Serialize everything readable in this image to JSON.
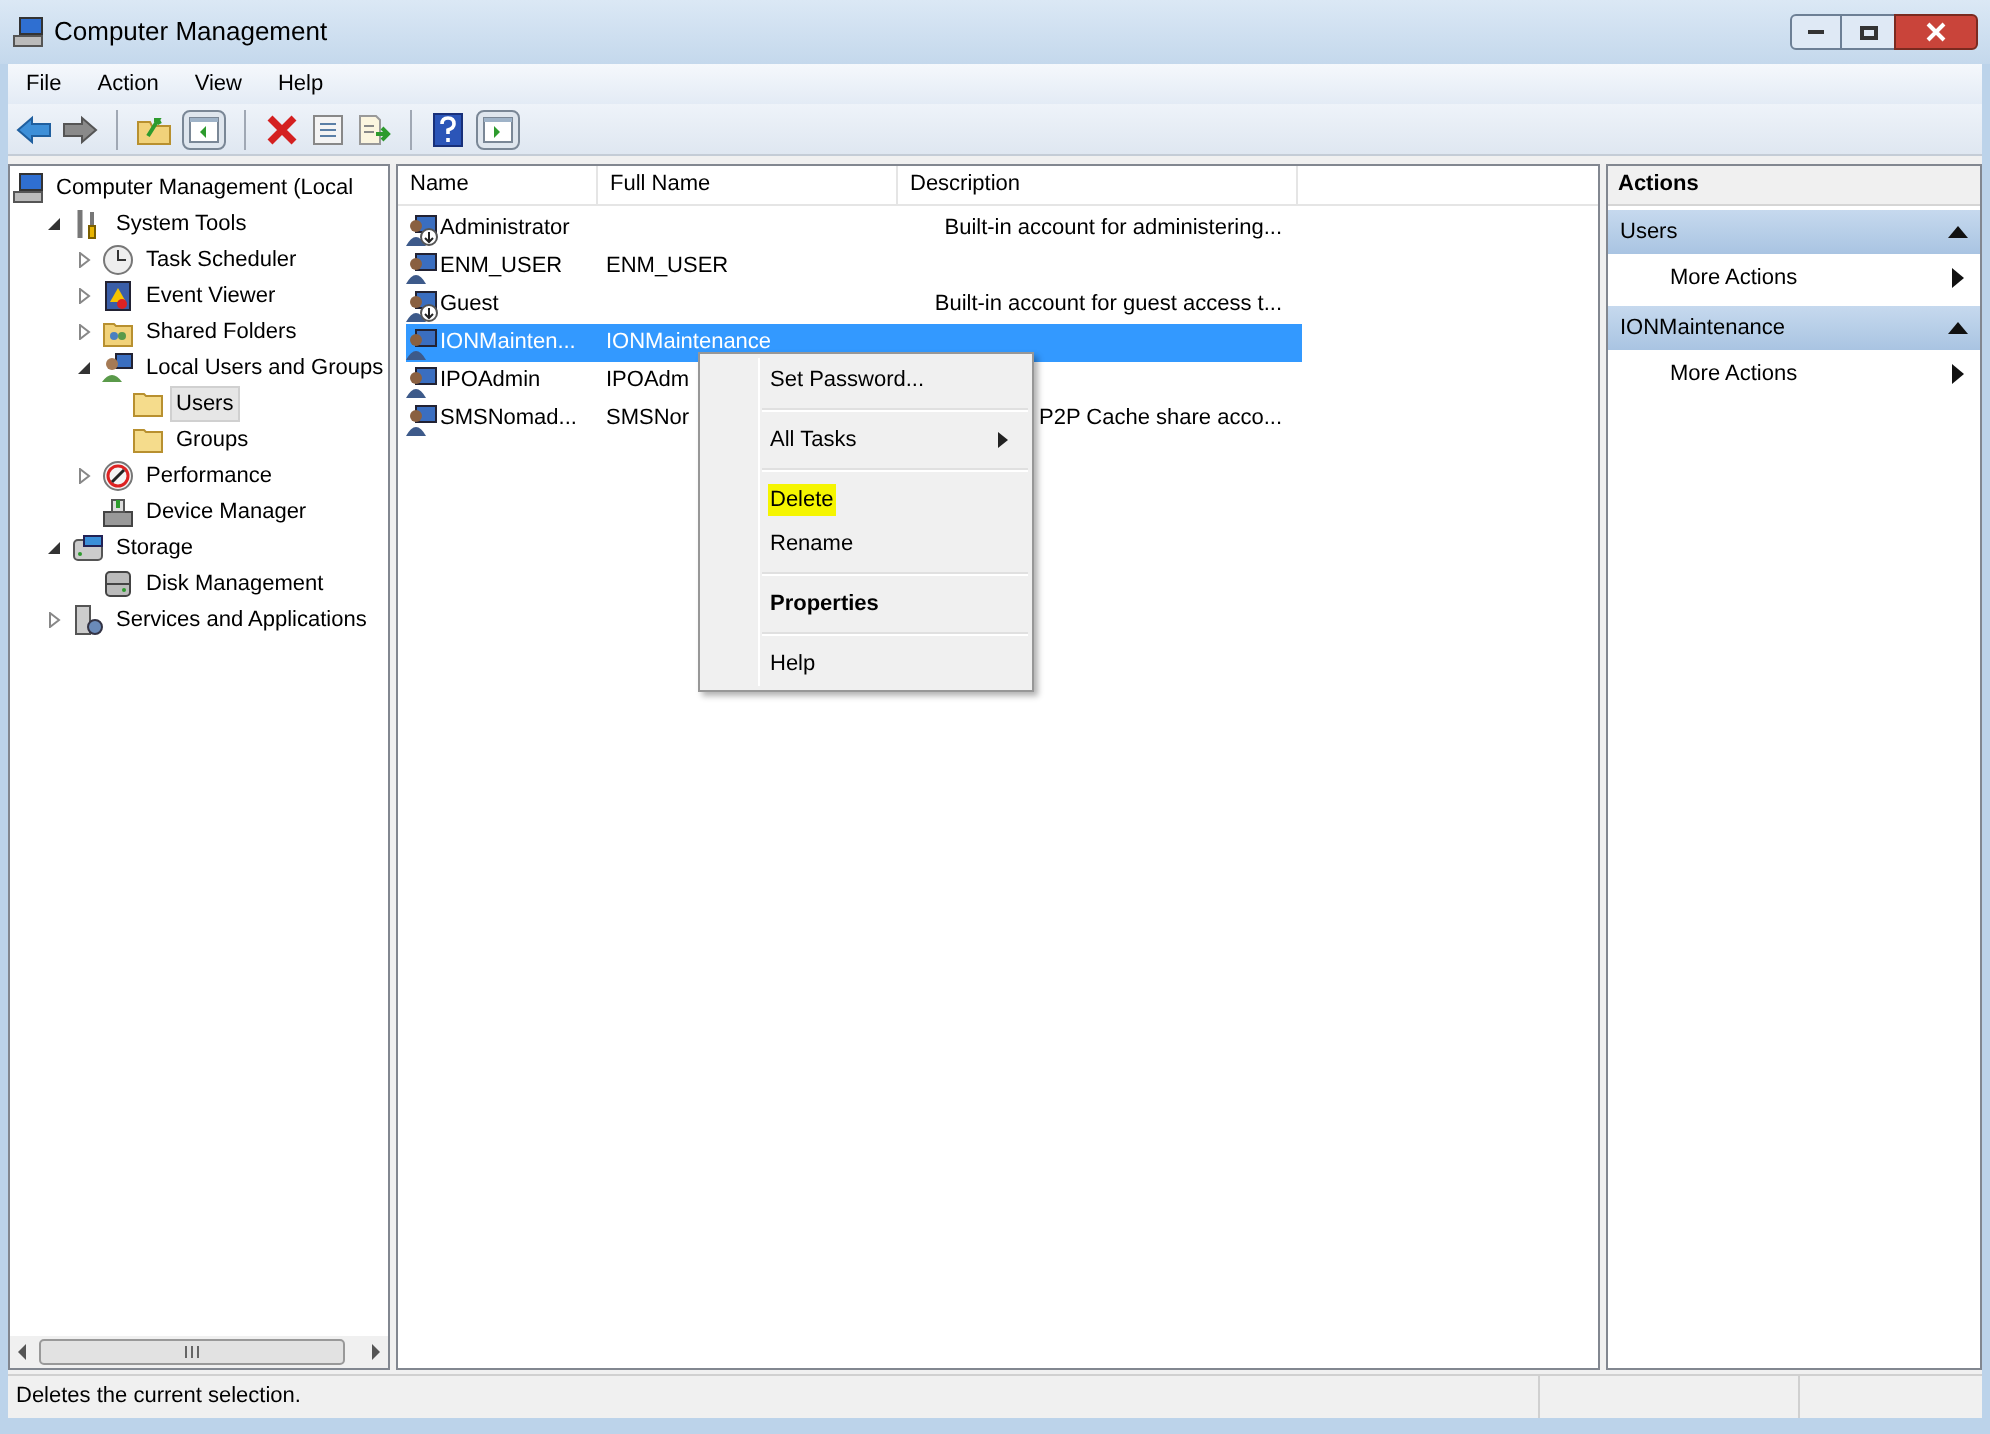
{
  "window": {
    "title": "Computer Management"
  },
  "menu_bar": [
    "File",
    "Action",
    "View",
    "Help"
  ],
  "toolbar": [
    {
      "kind": "back"
    },
    {
      "kind": "forward"
    },
    {
      "kind": "sep"
    },
    {
      "kind": "up"
    },
    {
      "kind": "tree"
    },
    {
      "kind": "sep"
    },
    {
      "kind": "delete"
    },
    {
      "kind": "properties"
    },
    {
      "kind": "export"
    },
    {
      "kind": "sep"
    },
    {
      "kind": "help"
    },
    {
      "kind": "pane"
    }
  ],
  "tree": [
    {
      "label": "Computer Management (Local",
      "kind": "computer",
      "selected": false,
      "children": [
        {
          "label": "System Tools",
          "kind": "tools",
          "expanded": true,
          "selected": false,
          "children": [
            {
              "label": "Task Scheduler",
              "kind": "clock",
              "expanded": false,
              "selected": false
            },
            {
              "label": "Event Viewer",
              "kind": "event",
              "expanded": false,
              "selected": false
            },
            {
              "label": "Shared Folders",
              "kind": "share",
              "expanded": false,
              "selected": false
            },
            {
              "label": "Local Users and Groups",
              "kind": "users",
              "expanded": true,
              "selected": false,
              "children": [
                {
                  "label": "Users",
                  "kind": "folder",
                  "selected": true
                },
                {
                  "label": "Groups",
                  "kind": "folder",
                  "selected": false
                }
              ]
            },
            {
              "label": "Performance",
              "kind": "performance",
              "expanded": false,
              "selected": false
            },
            {
              "label": "Device Manager",
              "kind": "device",
              "selected": false
            }
          ]
        },
        {
          "label": "Storage",
          "kind": "storage",
          "expanded": true,
          "selected": false,
          "children": [
            {
              "label": "Disk Management",
              "kind": "disk",
              "selected": false
            }
          ]
        },
        {
          "label": "Services and Applications",
          "kind": "services",
          "expanded": false,
          "selected": false
        }
      ]
    }
  ],
  "table": {
    "columns": [
      "Name",
      "Full Name",
      "Description"
    ],
    "rows": [
      {
        "name": "Administrator",
        "full_name": "",
        "description": "Built-in account for administering...",
        "disabled": true,
        "selected": false
      },
      {
        "name": "ENM_USER",
        "full_name": "ENM_USER",
        "description": "",
        "disabled": false,
        "selected": false
      },
      {
        "name": "Guest",
        "full_name": "",
        "description": "Built-in account for guest access t...",
        "disabled": true,
        "selected": false
      },
      {
        "name": "IONMainten...",
        "full_name": "IONMaintenance",
        "description": "",
        "disabled": false,
        "selected": true
      },
      {
        "name": "IPOAdmin",
        "full_name": "IPOAdm",
        "description": "",
        "disabled": false,
        "selected": false
      },
      {
        "name": "SMSNomad...",
        "full_name": "SMSNor",
        "description": "P2P Cache share acco...",
        "disabled": false,
        "selected": false
      }
    ]
  },
  "context_menu": {
    "groups": [
      [
        {
          "label": "Set Password...",
          "submenu": false,
          "bold": false,
          "highlighted": false
        }
      ],
      [
        {
          "label": "All Tasks",
          "submenu": true,
          "bold": false,
          "highlighted": false
        }
      ],
      [
        {
          "label": "Delete",
          "submenu": false,
          "bold": false,
          "highlighted": true
        },
        {
          "label": "Rename",
          "submenu": false,
          "bold": false,
          "highlighted": false
        }
      ],
      [
        {
          "label": "Properties",
          "submenu": false,
          "bold": true,
          "highlighted": false
        }
      ],
      [
        {
          "label": "Help",
          "submenu": false,
          "bold": false,
          "highlighted": false
        }
      ]
    ]
  },
  "actions": {
    "title": "Actions",
    "sections": [
      {
        "title": "Users",
        "expanded": true,
        "items": [
          {
            "label": "More Actions",
            "submenu": true
          }
        ]
      },
      {
        "title": "IONMaintenance",
        "expanded": true,
        "items": [
          {
            "label": "More Actions",
            "submenu": true
          }
        ]
      }
    ]
  },
  "status_bar": "Deletes the current selection."
}
